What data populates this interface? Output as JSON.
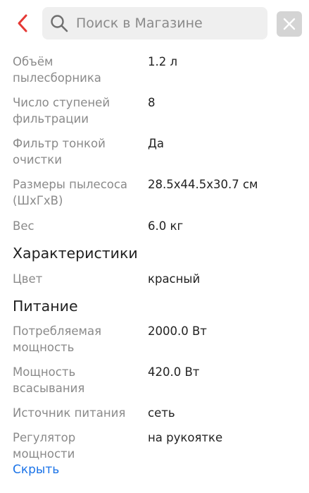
{
  "header": {
    "search_placeholder": "Поиск в Магазине",
    "accent_color": "#e53935",
    "back_icon": "chevron-left-icon",
    "search_icon": "search-icon",
    "close_icon": "close-icon"
  },
  "specs_top": [
    {
      "label": "Объём пылесборника",
      "value": "1.2 л"
    },
    {
      "label": "Число ступеней фильтрации",
      "value": "8"
    },
    {
      "label": "Фильтр тонкой очистки",
      "value": "Да"
    },
    {
      "label": "Размеры пылесоса (ШхГхВ)",
      "value": "28.5x44.5x30.7 см"
    },
    {
      "label": "Вес",
      "value": "6.0 кг"
    }
  ],
  "section_characteristics": {
    "title": "Характеристики",
    "items": [
      {
        "label": "Цвет",
        "value": "красный"
      }
    ]
  },
  "section_power": {
    "title": "Питание",
    "items": [
      {
        "label": "Потребляемая мощность",
        "value": "2000.0 Вт"
      },
      {
        "label": "Мощность всасывания",
        "value": "420.0 Вт"
      },
      {
        "label": "Источник питания",
        "value": "сеть"
      },
      {
        "label": "Регулятор мощности",
        "value": "на рукоятке"
      }
    ]
  },
  "hide_link": "Скрыть"
}
